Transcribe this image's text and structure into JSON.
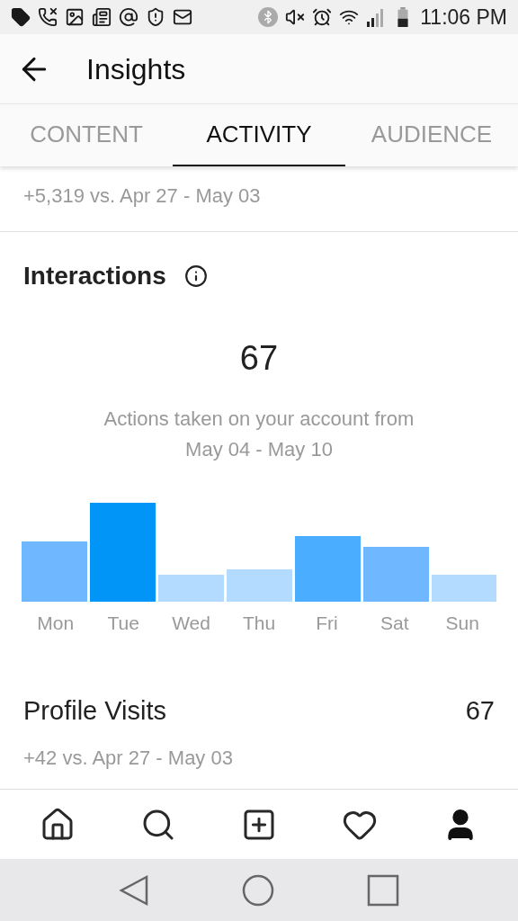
{
  "status_bar": {
    "time": "11:06 PM"
  },
  "header": {
    "title": "Insights"
  },
  "tabs": [
    {
      "label": "CONTENT",
      "selected": false
    },
    {
      "label": "ACTIVITY",
      "selected": true
    },
    {
      "label": "AUDIENCE",
      "selected": false
    }
  ],
  "previous_row": {
    "comparison": "+5,319 vs. Apr 27 - May 03"
  },
  "interactions": {
    "title": "Interactions",
    "total": "67",
    "description": "Actions taken on your account from",
    "range": "May 04 - May 10",
    "days": [
      "Mon",
      "Tue",
      "Wed",
      "Thu",
      "Fri",
      "Sat",
      "Sun"
    ]
  },
  "profile_visits": {
    "label": "Profile Visits",
    "value": "67",
    "comparison": "+42 vs. Apr 27 - May 03"
  },
  "bottom_nav": [
    {
      "kind": "home",
      "selected": false
    },
    {
      "kind": "search",
      "selected": false
    },
    {
      "kind": "add",
      "selected": false
    },
    {
      "kind": "activity",
      "selected": false
    },
    {
      "kind": "profile",
      "selected": true
    }
  ]
}
